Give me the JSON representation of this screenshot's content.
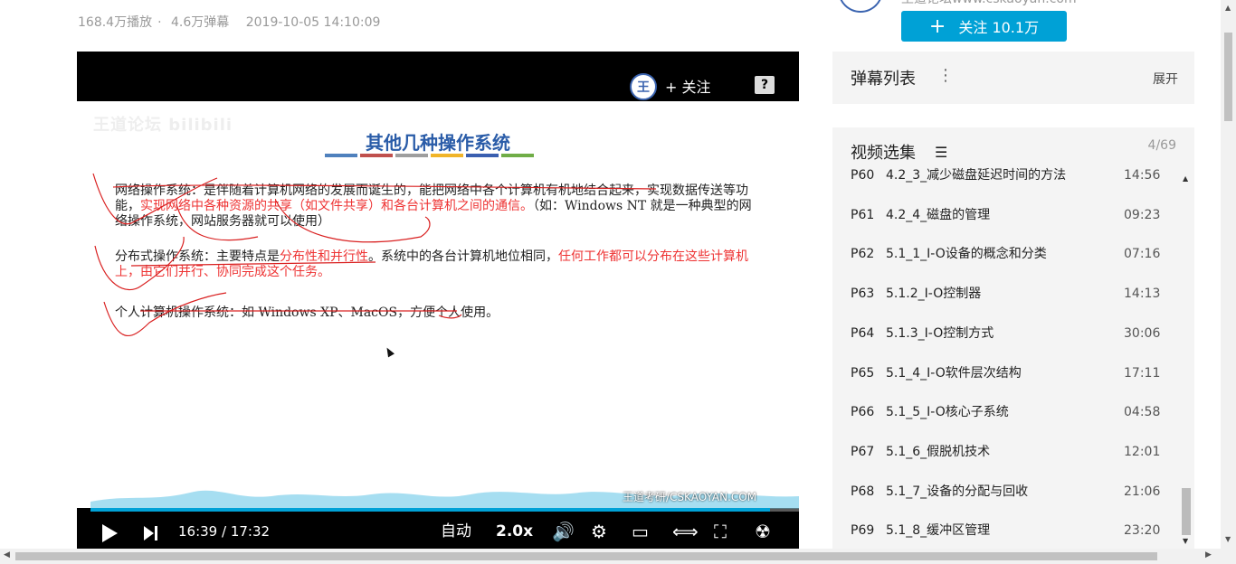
{
  "video_meta": {
    "plays": "168.4万播放",
    "danmaku": "4.6万弹幕",
    "date": "2019-10-05 14:10:09"
  },
  "player": {
    "follow_label": "+ 关注",
    "help_label": "?",
    "slide": {
      "watermark": "王道论坛 bilibili",
      "title": "其他几种操作系统",
      "stripe_colors": [
        "#4f81bd",
        "#c0504d",
        "#9e9e9e",
        "#f0b429",
        "#3a5fb0",
        "#70ad47"
      ],
      "p1_a": "网络操作系统：是伴随着计算机网络的发展而诞生的，能把网络中各个计算机有机地结合起来，实现数据传送等功能，",
      "p1_red": "实现网络中各种资源的共享（如文件共享）和各台计算机之间的通信。",
      "p1_b": "（如：Windows NT 就是一种典型的网络操作系统，网站服务器就可以使用）",
      "p2_a": "分布式操作系统：主要特点是",
      "p2_red1": "分布性和并行性",
      "p2_b": "。系统中的各台计算机地位相同，",
      "p2_red2": "任何工作都可以分布在这些计算机上，由它们并行、协同完成这个任务。",
      "p3": "个人计算机操作系统：如 Windows XP、MacOS，方便个人使用。"
    },
    "site_watermark": "王道考研/CSKAOYAN.COM",
    "progress_fraction": 0.9587,
    "controls": {
      "current_time": "16:39",
      "separator": " / ",
      "total_time": "17:32",
      "auto_label": "自动",
      "speed_label": "2.0x"
    }
  },
  "uploader": {
    "name": "王道论坛www.cskaoyan.com",
    "follow_label": "关注 10.1万"
  },
  "danmaku_panel": {
    "title": "弹幕列表",
    "expand_label": "展开"
  },
  "playlist": {
    "title": "视频选集",
    "count": "4/69",
    "items": [
      {
        "no": "P60",
        "name": "4.2_3_减少磁盘延迟时间的方法",
        "duration": "14:56"
      },
      {
        "no": "P61",
        "name": "4.2_4_磁盘的管理",
        "duration": "09:23"
      },
      {
        "no": "P62",
        "name": "5.1_1_I-O设备的概念和分类",
        "duration": "07:16"
      },
      {
        "no": "P63",
        "name": "5.1.2_I-O控制器",
        "duration": "14:13"
      },
      {
        "no": "P64",
        "name": "5.1.3_I-O控制方式",
        "duration": "30:06"
      },
      {
        "no": "P65",
        "name": "5.1_4_I-O软件层次结构",
        "duration": "17:11"
      },
      {
        "no": "P66",
        "name": "5.1_5_I-O核心子系统",
        "duration": "04:58"
      },
      {
        "no": "P67",
        "name": "5.1_6_假脱机技术",
        "duration": "12:01"
      },
      {
        "no": "P68",
        "name": "5.1_7_设备的分配与回收",
        "duration": "21:06"
      },
      {
        "no": "P69",
        "name": "5.1_8_缓冲区管理",
        "duration": "23:20"
      }
    ]
  },
  "colors": {
    "accent": "#00a1d6",
    "panel_bg": "#f4f4f4",
    "slide_title": "#2a5ca8",
    "highlight": "#e33333"
  },
  "icons": {
    "play": "play-icon",
    "next": "next-icon",
    "volume": "volume-icon",
    "settings": "gear-icon",
    "pip": "picture-in-picture-icon",
    "widescreen": "widescreen-icon",
    "fullscreen": "fullscreen-icon",
    "danmaku": "danmaku-icon",
    "list": "list-icon",
    "more": "more-icon"
  }
}
